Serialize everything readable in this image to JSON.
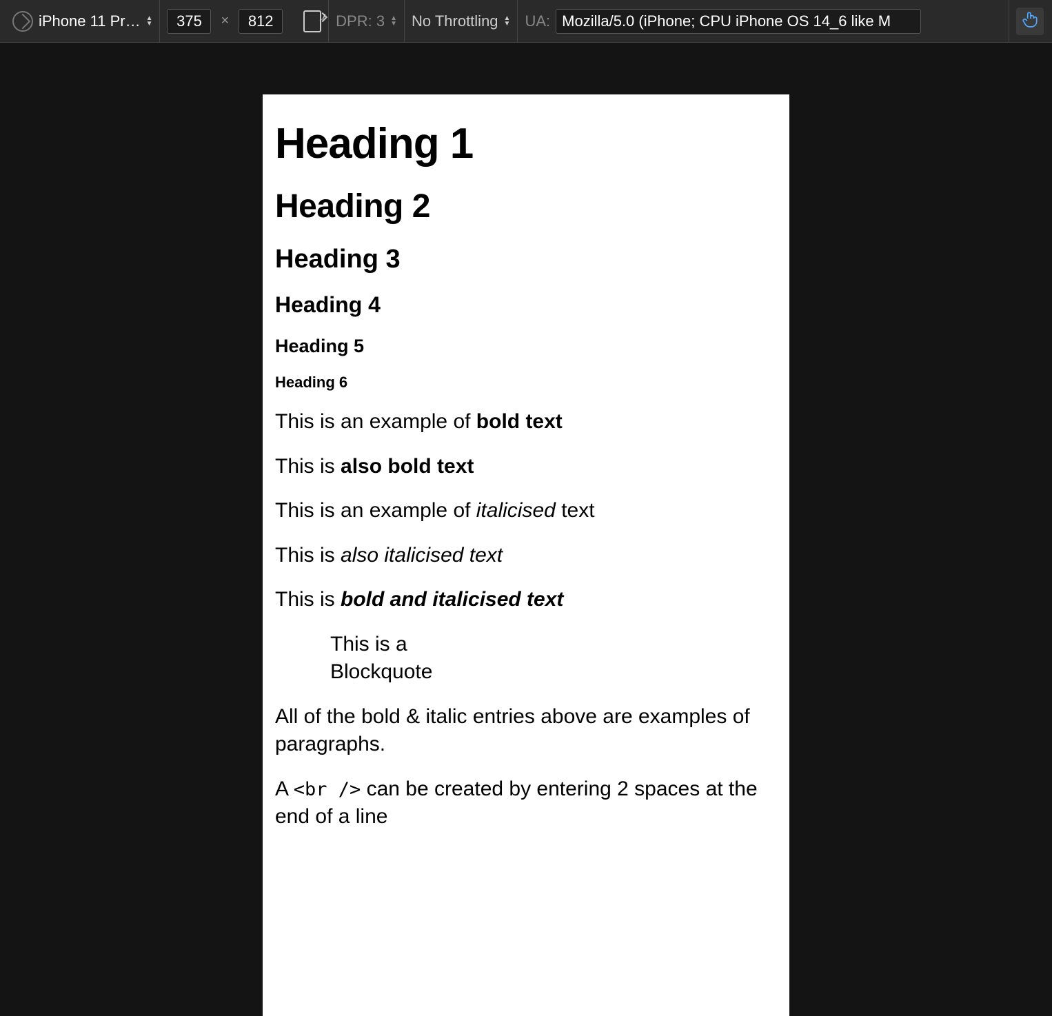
{
  "toolbar": {
    "device_label": "iPhone 11 Pr…",
    "width": "375",
    "height": "812",
    "dpr_label": "DPR: 3",
    "throttling_label": "No Throttling",
    "ua_label": "UA:",
    "ua_value": "Mozilla/5.0 (iPhone; CPU iPhone OS 14_6 like M"
  },
  "content": {
    "h1": "Heading 1",
    "h2": "Heading 2",
    "h3": "Heading 3",
    "h4": "Heading 4",
    "h5": "Heading 5",
    "h6": "Heading 6",
    "p_bold_pre": "This is an example of ",
    "p_bold_bold": "bold text",
    "p_alsobold_pre": "This is ",
    "p_alsobold_bold": "also bold text",
    "p_italic_pre": "This is an example of ",
    "p_italic_it": "italicised",
    "p_italic_post": " text",
    "p_alsoitalic_pre": "This is ",
    "p_alsoitalic_it": "also italicised text",
    "p_bolditalic_pre": "This is ",
    "p_bolditalic_bi": "bold and italicised text",
    "blockquote": "This is a Blockquote",
    "p_summary": "All of the bold & italic entries above are examples of paragraphs.",
    "p_br_pre": "A ",
    "p_br_code": "<br />",
    "p_br_post": " can be created by entering 2 spaces at the end of a line"
  }
}
